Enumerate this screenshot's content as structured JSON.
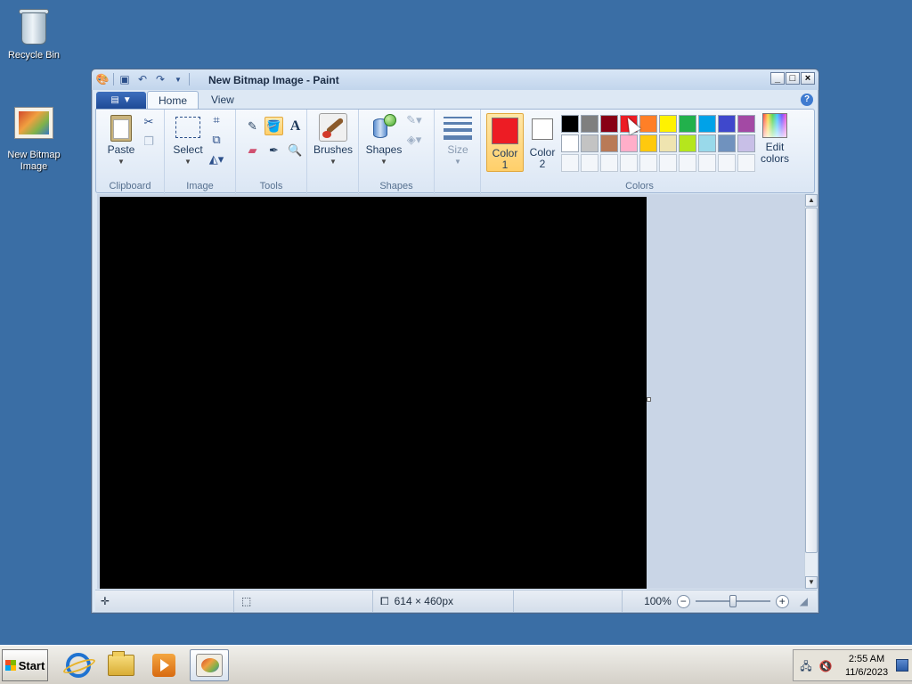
{
  "desktop": {
    "icons": [
      {
        "label": "Recycle Bin",
        "icon": "recycle-bin-icon"
      },
      {
        "label": "New Bitmap Image",
        "icon": "bitmap-image-icon"
      }
    ]
  },
  "window": {
    "title": "New Bitmap Image - Paint",
    "tabs": [
      "Home",
      "View"
    ],
    "active_tab": "Home"
  },
  "ribbon": {
    "clipboard": {
      "label": "Clipboard",
      "paste": "Paste"
    },
    "image": {
      "label": "Image",
      "select": "Select"
    },
    "tools": {
      "label": "Tools"
    },
    "brushes": {
      "label": "Brushes"
    },
    "shapes": {
      "group_label": "Shapes",
      "label": "Shapes"
    },
    "size": {
      "label": "Size"
    },
    "colors": {
      "label": "Colors",
      "color1": {
        "line1": "Color",
        "line2": "1",
        "value": "#ed1c24"
      },
      "color2": {
        "line1": "Color",
        "line2": "2",
        "value": "#ffffff"
      },
      "edit": {
        "line1": "Edit",
        "line2": "colors"
      },
      "palette_row1": [
        "#000000",
        "#7f7f7f",
        "#880015",
        "#ed1c24",
        "#ff7f27",
        "#fff200",
        "#22b14c",
        "#00a2e8",
        "#3f48cc",
        "#a349a4"
      ],
      "palette_row2": [
        "#ffffff",
        "#c3c3c3",
        "#b97a57",
        "#ffaec9",
        "#ffc90e",
        "#efe4b0",
        "#b5e61d",
        "#99d9ea",
        "#7092be",
        "#c8bfe7"
      ]
    }
  },
  "statusbar": {
    "dimensions": "614 × 460px",
    "zoom": "100%"
  },
  "taskbar": {
    "start": "Start",
    "time": "2:55 AM",
    "date": "11/6/2023"
  }
}
